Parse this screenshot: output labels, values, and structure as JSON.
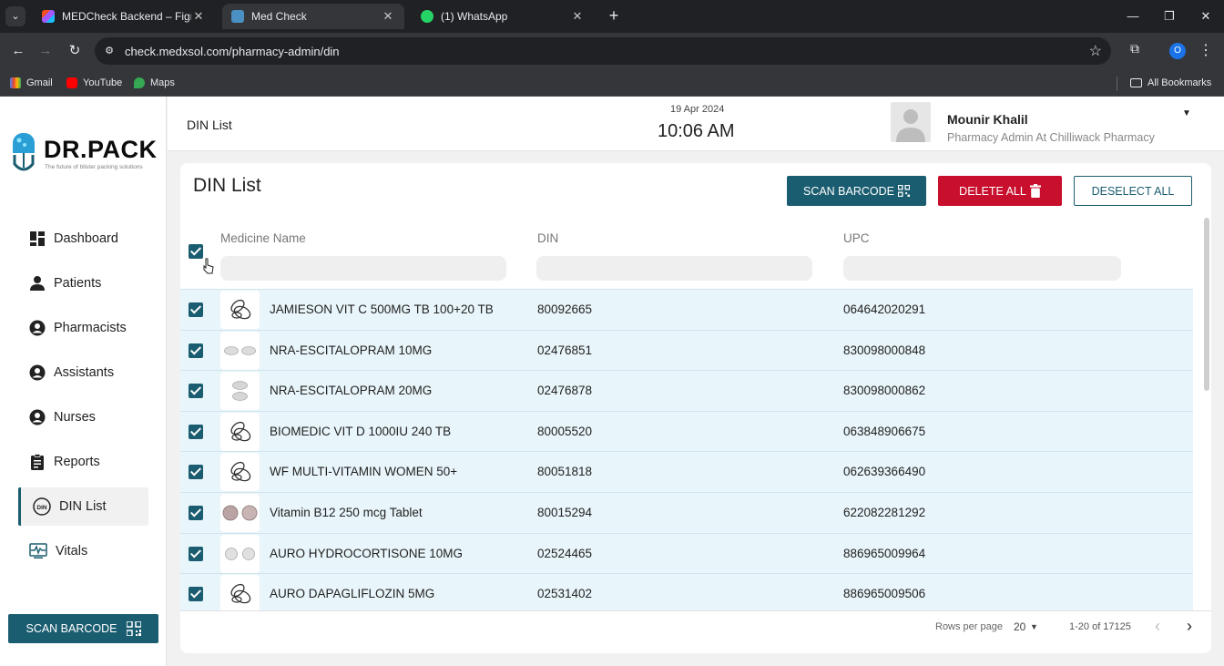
{
  "browser": {
    "tabs": [
      {
        "label": "MEDCheck Backend – Figma",
        "active": false,
        "favicon": "figma-icon"
      },
      {
        "label": "Med Check",
        "active": true,
        "favicon": "medcheck-icon"
      },
      {
        "label": "(1) WhatsApp",
        "active": false,
        "favicon": "whatsapp-icon"
      }
    ],
    "url": "check.medxsol.com/pharmacy-admin/din",
    "profile_initial": "O",
    "bookmarks": [
      {
        "label": "Gmail",
        "icon": "gmail-icon"
      },
      {
        "label": "YouTube",
        "icon": "youtube-icon"
      },
      {
        "label": "Maps",
        "icon": "maps-icon"
      }
    ],
    "all_bookmarks": "All Bookmarks"
  },
  "sidebar": {
    "logo_text": "DR.PACK",
    "logo_tagline": "The future of blister packing solutions",
    "items": [
      {
        "label": "Dashboard",
        "icon": "dashboard-icon"
      },
      {
        "label": "Patients",
        "icon": "person-icon"
      },
      {
        "label": "Pharmacists",
        "icon": "account-circle-icon"
      },
      {
        "label": "Assistants",
        "icon": "account-circle-icon"
      },
      {
        "label": "Nurses",
        "icon": "account-circle-icon"
      },
      {
        "label": "Reports",
        "icon": "clipboard-icon"
      },
      {
        "label": "DIN List",
        "icon": "din-icon",
        "active": true
      },
      {
        "label": "Vitals",
        "icon": "vitals-icon"
      }
    ],
    "scan_label": "SCAN BARCODE"
  },
  "header": {
    "title": "DIN List",
    "date": "19 Apr 2024",
    "time": "10:06 AM",
    "user_name": "Mounir Khalil",
    "user_role": "Pharmacy Admin At Chilliwack Pharmacy"
  },
  "card": {
    "title": "DIN List",
    "scan_label": "SCAN BARCODE",
    "delete_label": "DELETE ALL",
    "deselect_label": "DESELECT ALL",
    "columns": [
      "Medicine Name",
      "DIN",
      "UPC"
    ],
    "rows": [
      {
        "name": "JAMIESON VIT C 500MG TB 100+20 TB",
        "din": "80092665",
        "upc": "064642020291",
        "thumb": "pill-placeholder-icon"
      },
      {
        "name": "NRA-ESCITALOPRAM 10MG",
        "din": "02476851",
        "upc": "830098000848",
        "thumb": "white-oval-pills"
      },
      {
        "name": "NRA-ESCITALOPRAM 20MG",
        "din": "02476878",
        "upc": "830098000862",
        "thumb": "white-stacked-pills"
      },
      {
        "name": "BIOMEDIC VIT D 1000IU 240 TB",
        "din": "80005520",
        "upc": "063848906675",
        "thumb": "pill-placeholder-icon"
      },
      {
        "name": "WF MULTI-VITAMIN WOMEN 50+",
        "din": "80051818",
        "upc": "062639366490",
        "thumb": "pill-placeholder-icon"
      },
      {
        "name": "Vitamin B12 250 mcg Tablet",
        "din": "80015294",
        "upc": "622082281292",
        "thumb": "pink-round-pills"
      },
      {
        "name": "AURO HYDROCORTISONE 10MG",
        "din": "02524465",
        "upc": "886965009964",
        "thumb": "white-round-pills"
      },
      {
        "name": "AURO DAPAGLIFLOZIN 5MG",
        "din": "02531402",
        "upc": "886965009506",
        "thumb": "pill-placeholder-icon"
      }
    ],
    "rows_per_page_label": "Rows per page",
    "rows_per_page": "20",
    "range": "1-20 of 17125"
  },
  "colors": {
    "primary": "#1b5d70",
    "danger": "#c8102e",
    "row_bg": "#e8f5fa"
  }
}
